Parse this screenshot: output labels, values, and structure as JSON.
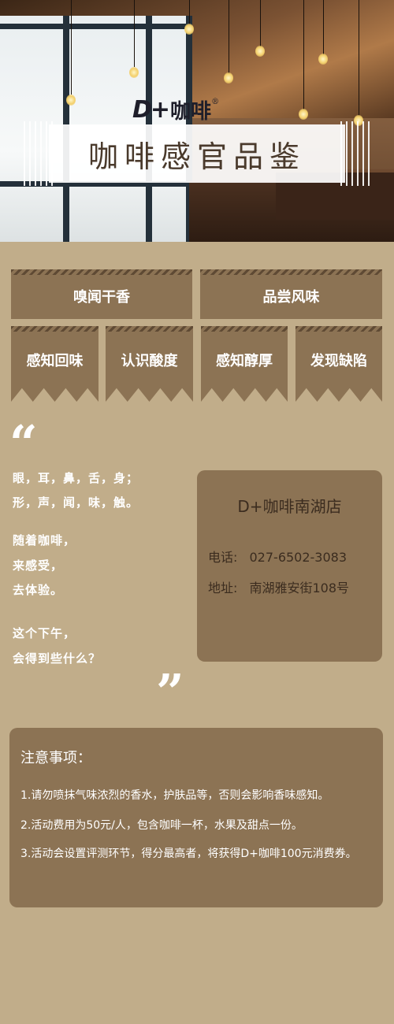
{
  "hero": {
    "logo_mark": "D+",
    "logo_text": "咖啡",
    "logo_reg": "®",
    "title": "咖啡感官品鉴"
  },
  "steps": {
    "row1": [
      "嗅闻干香",
      "品尝风味"
    ],
    "row2": [
      "感知回味",
      "认识酸度",
      "感知醇厚",
      "发现缺陷"
    ]
  },
  "quote": {
    "open_mark": "“",
    "close_mark": "”",
    "lines": [
      "眼，耳，鼻，舌，身；",
      "形，声，闻，味，触。",
      "随着咖啡，",
      "来感受，",
      "去体验。",
      "这个下午，",
      "会得到些什么？"
    ]
  },
  "store": {
    "name": "D+咖啡南湖店",
    "phone_label": "电话:",
    "phone": "027-6502-3083",
    "address_label": "地址:",
    "address": "南湖雅安街108号"
  },
  "notice": {
    "title": "注意事项：",
    "items": [
      "1.请勿喷抹气味浓烈的香水，护肤品等，否则会影响香味感知。",
      "2.活动费用为50元/人，包含咖啡一杯，水果及甜点一份。",
      "3.活动会设置评测环节，得分最高者，将获得D+咖啡100元消费券。"
    ]
  },
  "colors": {
    "background": "#c1ad8a",
    "panel": "#8c7354",
    "panel_text": "#3b2c1f",
    "text_light": "#ffffff"
  }
}
